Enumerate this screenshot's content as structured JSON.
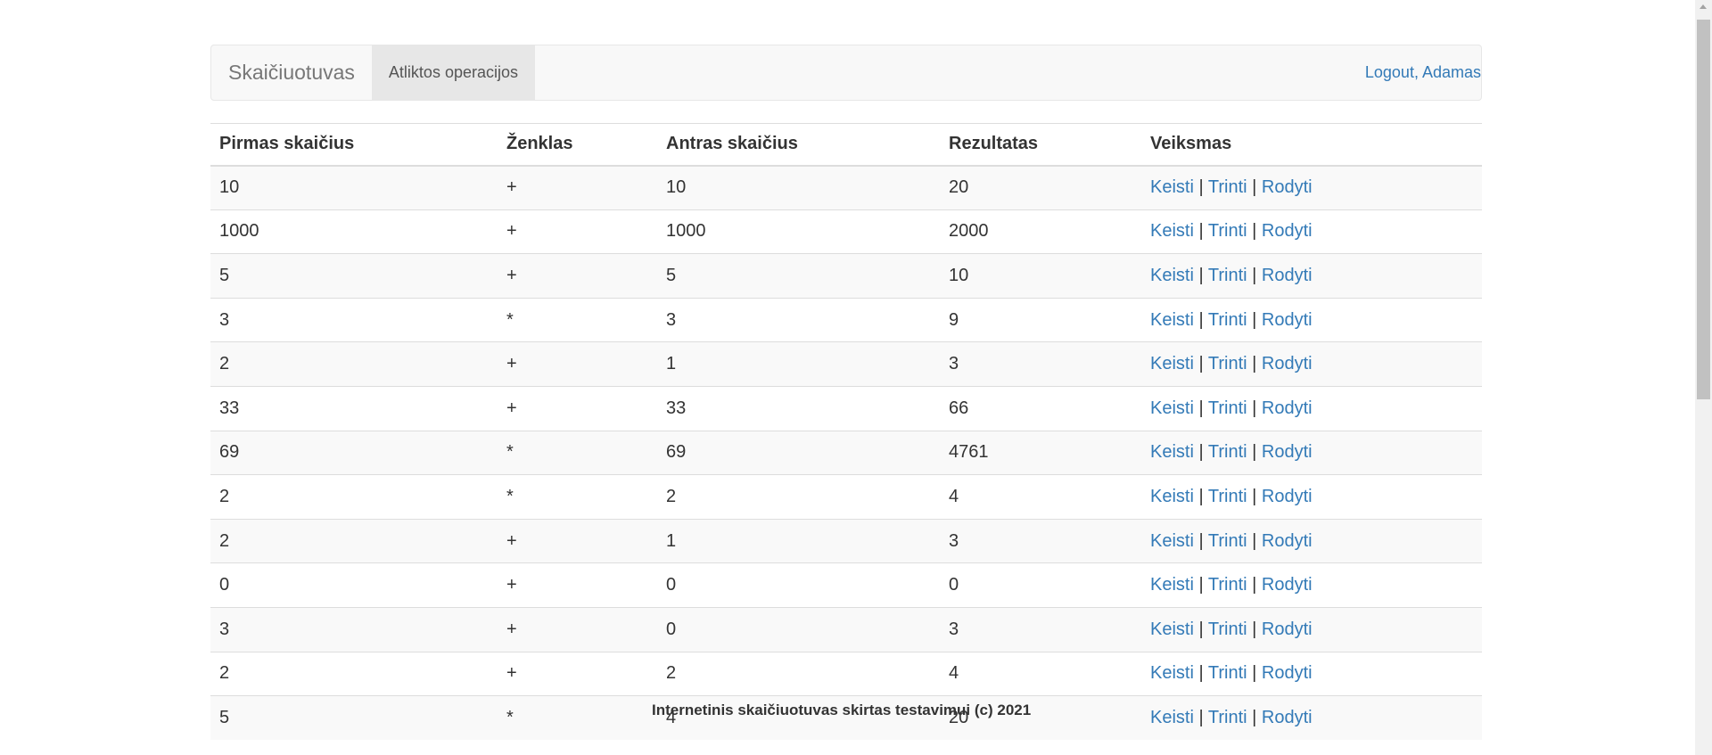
{
  "navbar": {
    "brand": "Skaičiuotuvas",
    "active_tab": "Atliktos operacijos",
    "logout": "Logout, Adamas"
  },
  "table": {
    "headers": [
      "Pirmas skaičius",
      "Ženklas",
      "Antras skaičius",
      "Rezultatas",
      "Veiksmas"
    ],
    "actions": {
      "edit": "Keisti",
      "delete": "Trinti",
      "view": "Rodyti",
      "separator": "|"
    },
    "rows": [
      [
        "10",
        "+",
        "10",
        "20"
      ],
      [
        "1000",
        "+",
        "1000",
        "2000"
      ],
      [
        "5",
        "+",
        "5",
        "10"
      ],
      [
        "3",
        "*",
        "3",
        "9"
      ],
      [
        "2",
        "+",
        "1",
        "3"
      ],
      [
        "33",
        "+",
        "33",
        "66"
      ],
      [
        "69",
        "*",
        "69",
        "4761"
      ],
      [
        "2",
        "*",
        "2",
        "4"
      ],
      [
        "2",
        "+",
        "1",
        "3"
      ],
      [
        "0",
        "+",
        "0",
        "0"
      ],
      [
        "3",
        "+",
        "0",
        "3"
      ],
      [
        "2",
        "+",
        "2",
        "4"
      ],
      [
        "5",
        "*",
        "4",
        "20"
      ]
    ]
  },
  "footer": {
    "text": "Internetinis skaičiuotuvas skirtas testavimui (c) 2021"
  }
}
